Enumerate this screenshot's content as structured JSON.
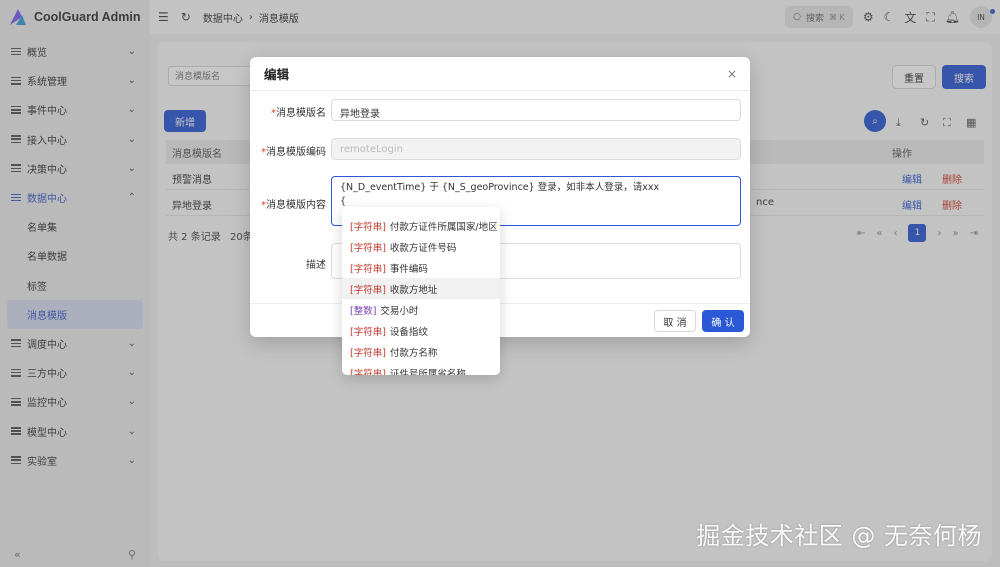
{
  "app": {
    "title": "CoolGuard Admin",
    "brand_colors": [
      "#7b5cf0",
      "#3a9bdc"
    ]
  },
  "sidebar": {
    "items": [
      {
        "label": "概览",
        "chevron": "⌄"
      },
      {
        "label": "系统管理",
        "chevron": "⌄"
      },
      {
        "label": "事件中心",
        "chevron": "⌄"
      },
      {
        "label": "接入中心",
        "chevron": "⌄"
      },
      {
        "label": "决策中心",
        "chevron": "⌄"
      },
      {
        "label": "数据中心",
        "chevron": "⌃"
      },
      {
        "label": "调度中心",
        "chevron": "⌄"
      },
      {
        "label": "三方中心",
        "chevron": "⌄"
      },
      {
        "label": "监控中心",
        "chevron": "⌄"
      },
      {
        "label": "模型中心",
        "chevron": "⌄"
      },
      {
        "label": "实验室",
        "chevron": "⌄"
      }
    ],
    "sub_items": [
      "名单集",
      "名单数据",
      "标签",
      "消息模版"
    ],
    "collapse_icon": "«",
    "pin_icon": "⚲"
  },
  "topbar": {
    "breadcrumb": [
      "数据中心",
      "消息模版"
    ],
    "search_label": "搜索",
    "search_shortcut": "⌘ K",
    "avatar_initials": "IN"
  },
  "filter": {
    "placeholder": "消息模版名",
    "reset_label": "重置",
    "search_label": "搜索"
  },
  "table": {
    "new_label": "新增",
    "headers": {
      "name": "消息模版名",
      "action": "操作"
    },
    "rows": [
      {
        "name": "预警消息",
        "extra": "",
        "edit": "编辑",
        "delete": "删除"
      },
      {
        "name": "异地登录",
        "extra": "nce",
        "edit": "编辑",
        "delete": "删除"
      }
    ],
    "total": "共 2 条记录",
    "page_size": "20条/",
    "current_page": "1"
  },
  "modal": {
    "title": "编辑",
    "close_icon": "×",
    "fields": {
      "name_label": "消息模版名",
      "name_value": "异地登录",
      "code_label": "消息模版编码",
      "code_placeholder": "remoteLogin",
      "content_label": "消息模版内容",
      "content_line1": "{N_D_eventTime} 于 {N_S_geoProvince} 登录，如非本人登录，请xxx",
      "content_line2": "{",
      "desc_label": "描述"
    },
    "cancel_label": "取 消",
    "confirm_label": "确 认"
  },
  "dropdown": {
    "items": [
      {
        "type": "[字符串]",
        "label": "付款方证件所属国家/地区",
        "kind": "str"
      },
      {
        "type": "[字符串]",
        "label": "收款方证件号码",
        "kind": "str"
      },
      {
        "type": "[字符串]",
        "label": "事件编码",
        "kind": "str"
      },
      {
        "type": "[字符串]",
        "label": "收款方地址",
        "kind": "str"
      },
      {
        "type": "[整数]",
        "label": "交易小时",
        "kind": "int"
      },
      {
        "type": "[字符串]",
        "label": "设备指纹",
        "kind": "str"
      },
      {
        "type": "[字符串]",
        "label": "付款方名称",
        "kind": "str"
      },
      {
        "type": "[字符串]",
        "label": "证件号所属省名称",
        "kind": "str"
      }
    ]
  },
  "watermark": "掘金技术社区 @ 无奈何杨"
}
